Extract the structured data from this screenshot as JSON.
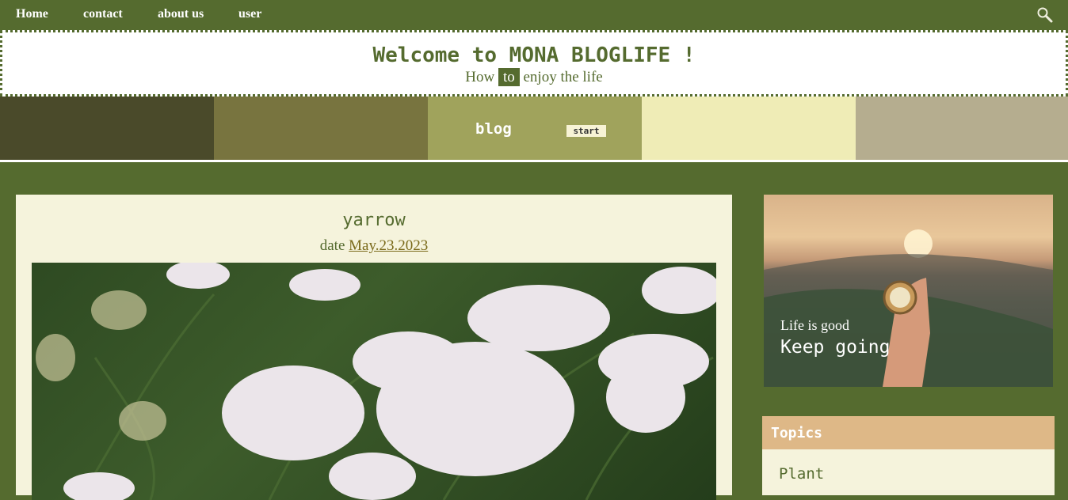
{
  "nav": {
    "home": "Home",
    "contact": "contact",
    "about": "about us",
    "user": "user",
    "search_icon": "search-icon"
  },
  "header": {
    "title": "Welcome to MONA BLOGLIFE !",
    "tagline_before": "How",
    "tagline_highlight": "to",
    "tagline_after": "enjoy the life"
  },
  "banner": {
    "blog_label": "blog",
    "start_label": "start",
    "swatch_colors": [
      "#4a4a2a",
      "#78743f",
      "#a0a35c",
      "#efecb6",
      "#b5ad8f"
    ]
  },
  "post": {
    "title": "yarrow",
    "date_label": "date",
    "date_value": "May.23.2023"
  },
  "sidebar": {
    "hero_line1": "Life is good",
    "hero_line2": "Keep going",
    "topics_title": "Topics",
    "topics": [
      "Plant"
    ]
  },
  "colors": {
    "primary": "#556b2f",
    "topics_header": "#deb887",
    "panel_bg": "#f5f3dc"
  }
}
